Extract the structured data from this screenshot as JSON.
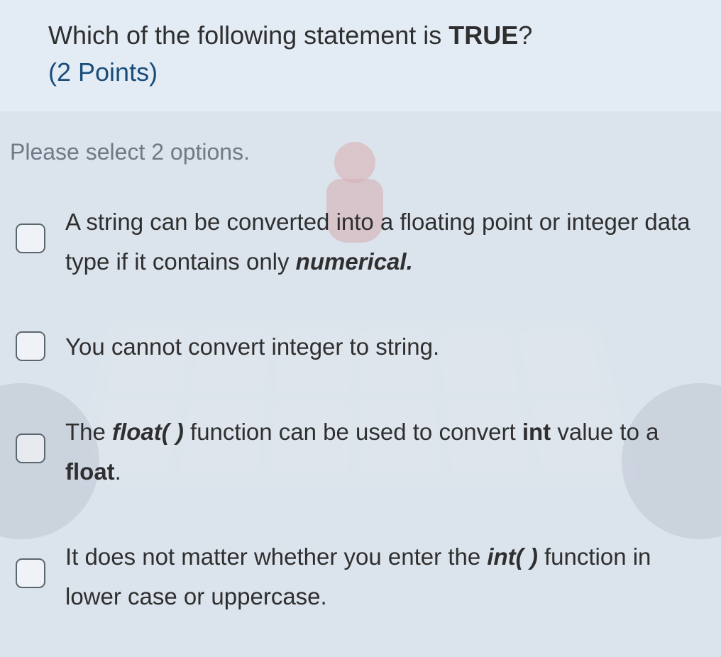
{
  "question": {
    "prefix": "Which of the following statement is ",
    "emph": "TRUE",
    "suffix": "?",
    "points": "(2 Points)"
  },
  "instruction": "Please select 2 options.",
  "options": [
    {
      "parts": [
        {
          "t": "A string can be converted into a floating point or integer data type if it contains only "
        },
        {
          "t": "numerical.",
          "style": "ibold"
        }
      ],
      "multiline": true
    },
    {
      "parts": [
        {
          "t": "You cannot convert integer to string."
        }
      ],
      "multiline": false
    },
    {
      "parts": [
        {
          "t": "The "
        },
        {
          "t": "float( )",
          "style": "ibold"
        },
        {
          "t": " function can be used to convert "
        },
        {
          "t": "int",
          "style": "bold"
        },
        {
          "t": " value to a "
        },
        {
          "t": "float",
          "style": "bold"
        },
        {
          "t": "."
        }
      ],
      "multiline": true
    },
    {
      "parts": [
        {
          "t": "It does not matter whether you enter the "
        },
        {
          "t": "int( )",
          "style": "ibold"
        },
        {
          "t": " function in lower case or uppercase."
        }
      ],
      "multiline": true
    }
  ]
}
